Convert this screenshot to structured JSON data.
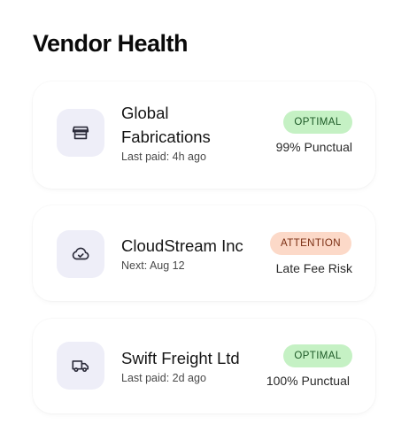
{
  "header": {
    "title": "Vendor Health"
  },
  "vendors": [
    {
      "name": "Global Fabrications",
      "subtitle": "Last paid: 4h ago",
      "status": "OPTIMAL",
      "metric": "99% Punctual",
      "icon": "storefront-icon"
    },
    {
      "name": "CloudStream Inc",
      "subtitle": "Next: Aug 12",
      "status": "ATTENTION",
      "metric": "Late Fee Risk",
      "icon": "cloud-check-icon"
    },
    {
      "name": "Swift Freight Ltd",
      "subtitle": "Last paid: 2d ago",
      "status": "OPTIMAL",
      "metric": "100% Punctual",
      "icon": "truck-icon"
    }
  ],
  "colors": {
    "icon_bg": "#eeeef8",
    "optimal_bg": "#c5f1c4",
    "optimal_text": "#1d5a27",
    "attention_bg": "#fcd9c8",
    "attention_text": "#7a2e12"
  }
}
